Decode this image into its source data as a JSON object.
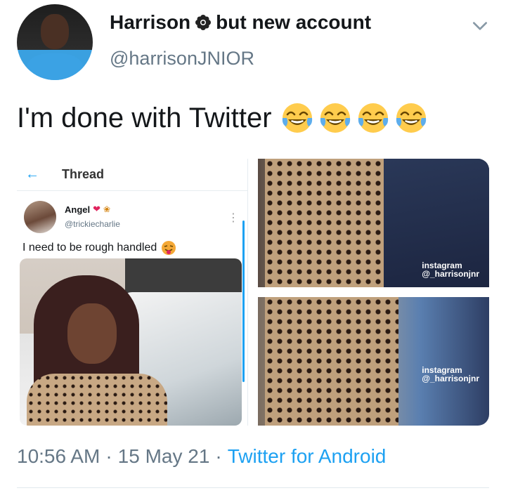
{
  "tweet": {
    "author": {
      "display_name_part1": "Harrison",
      "display_name_part2": "but new account",
      "handle": "@harrisonJNIOR",
      "flower_icon": "flower-icon"
    },
    "text": "I'm done with Twitter",
    "emojis": [
      "face-with-tears-of-joy",
      "face-with-tears-of-joy",
      "face-with-tears-of-joy",
      "face-with-tears-of-joy"
    ],
    "time": "10:56 AM",
    "separator": "·",
    "date": "15 May 21",
    "source": "Twitter for Android"
  },
  "media": {
    "screenshot": {
      "header_title": "Thread",
      "author_name": "Angel",
      "author_handle": "@trickiecharlie",
      "post_text": "I need to be rough handled"
    },
    "watermark_top": "instagram\n@_harrisonjnr",
    "watermark_bottom": "instagram\n@_harrisonjnr"
  },
  "colors": {
    "link": "#1da1f2",
    "secondary_text": "#657786",
    "primary_text": "#14171a"
  }
}
